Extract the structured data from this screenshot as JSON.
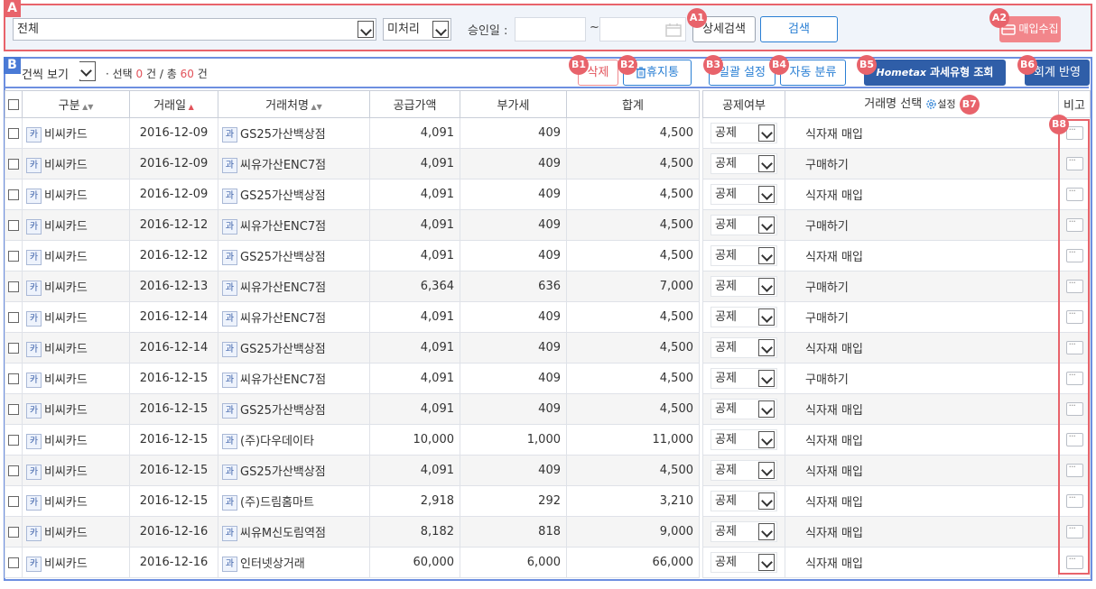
{
  "search": {
    "marker": "A",
    "category_value": "전체",
    "status_value": "미처리",
    "date_label": "승인일 :",
    "date_sep": "~",
    "detail_search_label": "상세검색",
    "search_label": "검색",
    "collect_label": "매입수집"
  },
  "markers": {
    "a1": "A1",
    "a2": "A2",
    "b": "B",
    "b1": "B1",
    "b2": "B2",
    "b3": "B3",
    "b4": "B4",
    "b5": "B5",
    "b6": "B6",
    "b7": "B7",
    "b8": "B8"
  },
  "toolbar": {
    "view_label": "건씩 보기",
    "select_prefix": "· 선택",
    "select_count": "0",
    "select_mid": "건 / 총",
    "total_count": "60",
    "total_suffix": "건",
    "delete_label": "삭제",
    "trash_label": "휴지통",
    "bulk_label": "일괄 설정",
    "auto_label": "자동 분류",
    "hometax_label": "Hometax",
    "taxtype_label": "과세유형 조회",
    "accounting_label": "회계 반영"
  },
  "columns": {
    "type": "구분",
    "date": "거래일",
    "vendor": "거래처명",
    "supply": "공급가액",
    "vat": "부가세",
    "total": "합계",
    "deduct": "공제여부",
    "desc": "거래명 선택",
    "settings": "설정",
    "memo": "비고"
  },
  "tag_card": "카",
  "tag_vendor": "과",
  "rows": [
    {
      "type": "비씨카드",
      "date": "2016-12-09",
      "vendor": "GS25가산백상점",
      "supply": "4,091",
      "vat": "409",
      "total": "4,500",
      "deduct": "공제",
      "desc": "식자재 매입"
    },
    {
      "type": "비씨카드",
      "date": "2016-12-09",
      "vendor": "씨유가산ENC7점",
      "supply": "4,091",
      "vat": "409",
      "total": "4,500",
      "deduct": "공제",
      "desc": "구매하기"
    },
    {
      "type": "비씨카드",
      "date": "2016-12-09",
      "vendor": "GS25가산백상점",
      "supply": "4,091",
      "vat": "409",
      "total": "4,500",
      "deduct": "공제",
      "desc": "식자재 매입"
    },
    {
      "type": "비씨카드",
      "date": "2016-12-12",
      "vendor": "씨유가산ENC7점",
      "supply": "4,091",
      "vat": "409",
      "total": "4,500",
      "deduct": "공제",
      "desc": "구매하기"
    },
    {
      "type": "비씨카드",
      "date": "2016-12-12",
      "vendor": "GS25가산백상점",
      "supply": "4,091",
      "vat": "409",
      "total": "4,500",
      "deduct": "공제",
      "desc": "식자재 매입"
    },
    {
      "type": "비씨카드",
      "date": "2016-12-13",
      "vendor": "씨유가산ENC7점",
      "supply": "6,364",
      "vat": "636",
      "total": "7,000",
      "deduct": "공제",
      "desc": "구매하기"
    },
    {
      "type": "비씨카드",
      "date": "2016-12-14",
      "vendor": "씨유가산ENC7점",
      "supply": "4,091",
      "vat": "409",
      "total": "4,500",
      "deduct": "공제",
      "desc": "구매하기"
    },
    {
      "type": "비씨카드",
      "date": "2016-12-14",
      "vendor": "GS25가산백상점",
      "supply": "4,091",
      "vat": "409",
      "total": "4,500",
      "deduct": "공제",
      "desc": "식자재 매입"
    },
    {
      "type": "비씨카드",
      "date": "2016-12-15",
      "vendor": "씨유가산ENC7점",
      "supply": "4,091",
      "vat": "409",
      "total": "4,500",
      "deduct": "공제",
      "desc": "구매하기"
    },
    {
      "type": "비씨카드",
      "date": "2016-12-15",
      "vendor": "GS25가산백상점",
      "supply": "4,091",
      "vat": "409",
      "total": "4,500",
      "deduct": "공제",
      "desc": "식자재 매입"
    },
    {
      "type": "비씨카드",
      "date": "2016-12-15",
      "vendor": "(주)다우데이타",
      "supply": "10,000",
      "vat": "1,000",
      "total": "11,000",
      "deduct": "공제",
      "desc": "식자재 매입"
    },
    {
      "type": "비씨카드",
      "date": "2016-12-15",
      "vendor": "GS25가산백상점",
      "supply": "4,091",
      "vat": "409",
      "total": "4,500",
      "deduct": "공제",
      "desc": "식자재 매입"
    },
    {
      "type": "비씨카드",
      "date": "2016-12-15",
      "vendor": "(주)드림홈마트",
      "supply": "2,918",
      "vat": "292",
      "total": "3,210",
      "deduct": "공제",
      "desc": "식자재 매입"
    },
    {
      "type": "비씨카드",
      "date": "2016-12-16",
      "vendor": "씨유M신도림역점",
      "supply": "8,182",
      "vat": "818",
      "total": "9,000",
      "deduct": "공제",
      "desc": "식자재 매입"
    },
    {
      "type": "비씨카드",
      "date": "2016-12-16",
      "vendor": "인터넷상거래",
      "supply": "60,000",
      "vat": "6,000",
      "total": "66,000",
      "deduct": "공제",
      "desc": "식자재 매입"
    }
  ]
}
